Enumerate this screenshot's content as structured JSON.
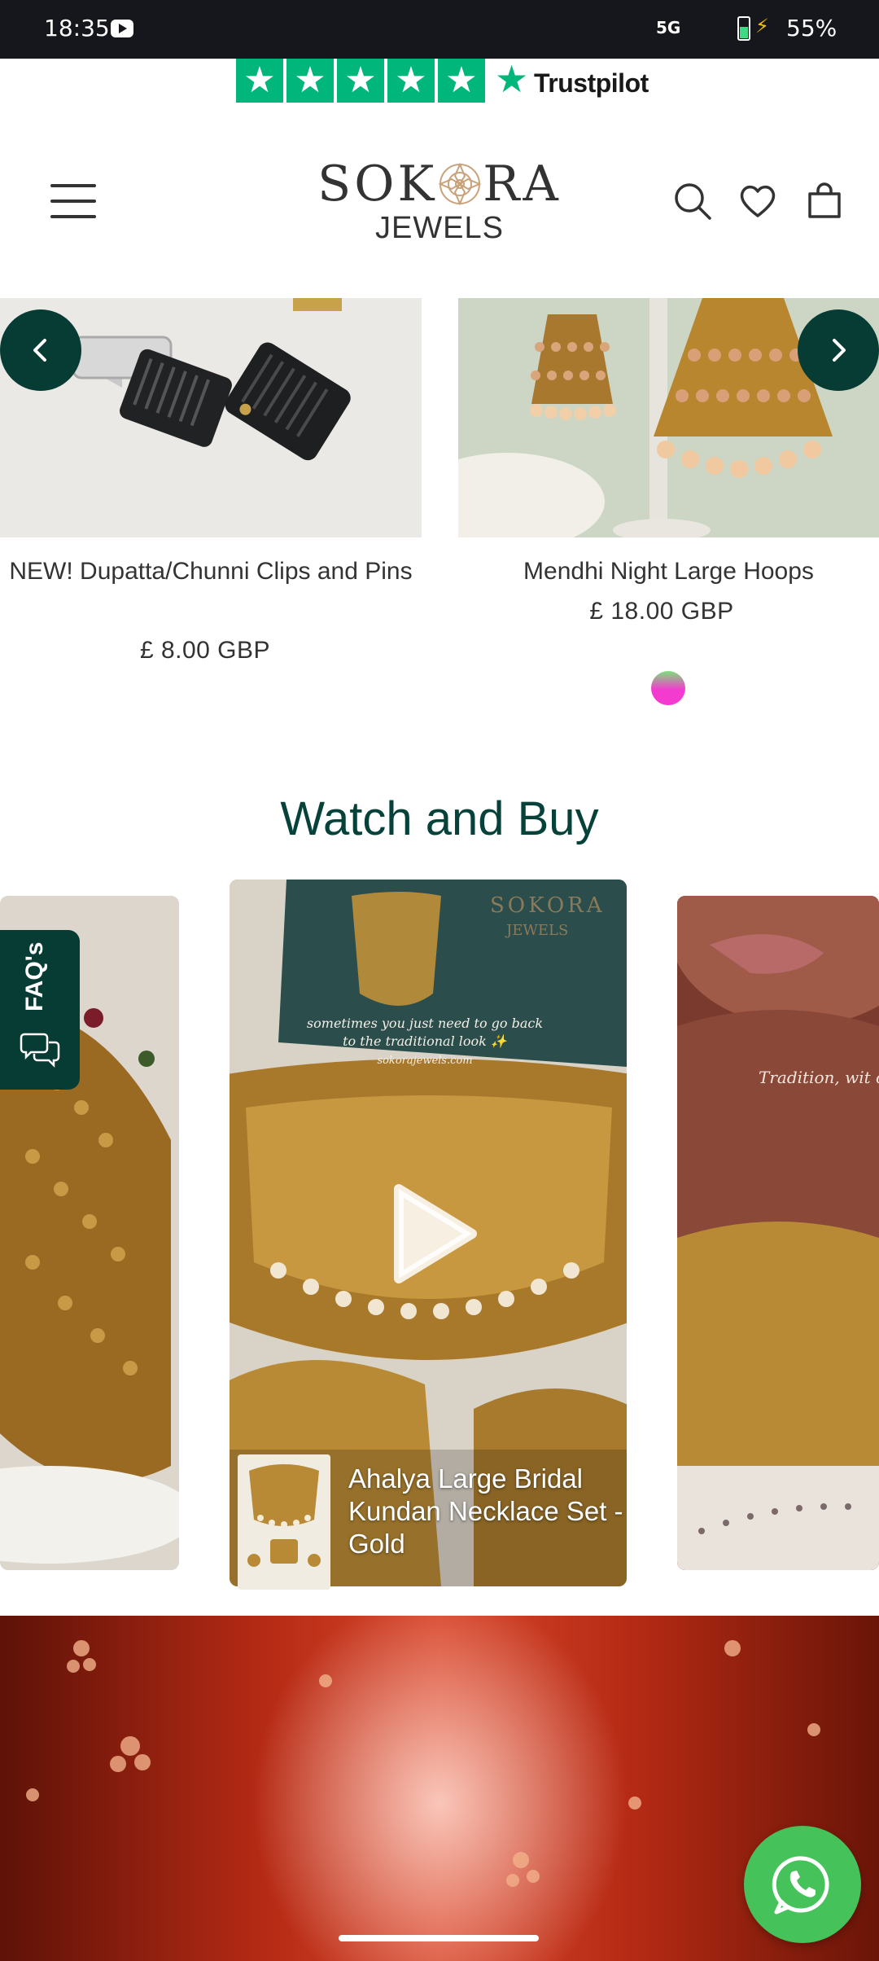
{
  "status_bar": {
    "time": "18:35",
    "network": "5G",
    "battery": "55%"
  },
  "trustpilot": {
    "label": "Trustpilot",
    "stars": 5
  },
  "header": {
    "brand_name": "SOKORA",
    "brand_sub": "JEWELS"
  },
  "products": [
    {
      "title": "NEW! Dupatta/Chunni Clips and Pins",
      "price": "£ 8.00 GBP"
    },
    {
      "title": "Mendhi Night Large Hoops",
      "price": "£ 18.00 GBP"
    }
  ],
  "watch_and_buy": {
    "title": "Watch and Buy",
    "faq_label": "FAQ's",
    "featured_caption": "Ahalya Large Bridal Kundan Necklace Set - Gold",
    "overlay_text_center": "sometimes you just need to go back to the traditional look ✨",
    "overlay_site": "sokorajewels.com",
    "overlay_text_right": "Tradition, wit colo"
  },
  "colors": {
    "brand_green": "#073c34",
    "heading_green": "#06423a",
    "trustpilot_green": "#00b67a",
    "whatsapp_green": "#45c35a"
  }
}
